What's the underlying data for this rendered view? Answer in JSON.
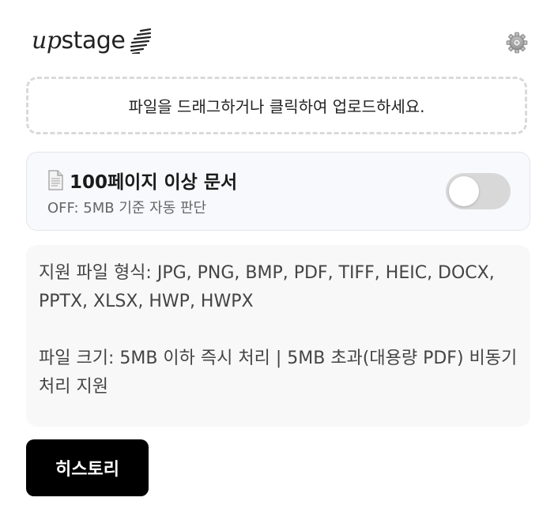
{
  "header": {
    "logo_text_prefix": "up",
    "logo_text_suffix": "stage",
    "logo_icon": "upstage-stripes-icon",
    "settings_icon": "gear-icon"
  },
  "dropzone": {
    "label": "파일을 드래그하거나 클릭하여 업로드하세요."
  },
  "large_doc_option": {
    "icon": "document-icon",
    "title": "100페이지 이상 문서",
    "subtitle": "OFF: 5MB 기준 자동 판단",
    "enabled": false
  },
  "info": {
    "formats": "지원 파일 형식: JPG, PNG, BMP, PDF, TIFF, HEIC, DOCX, PPTX, XLSX, HWP, HWPX",
    "size": "파일 크기: 5MB 이하 즉시 처리 | 5MB 초과(대용량 PDF) 비동기 처리 지원"
  },
  "actions": {
    "history_label": "히스토리"
  },
  "colors": {
    "primary_button_bg": "#000000",
    "toggle_off": "#d8d8d8",
    "card_bg": "#f7f9fc",
    "info_bg": "#f8f8f8"
  }
}
